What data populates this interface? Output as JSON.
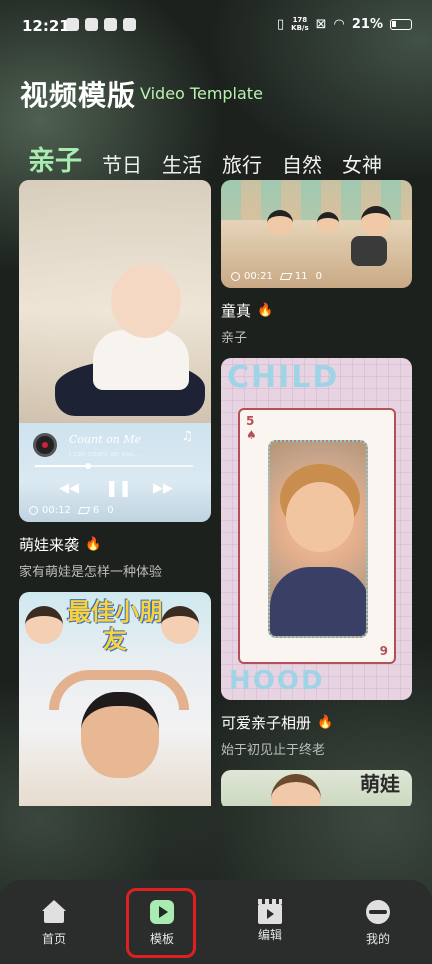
{
  "status_bar": {
    "time": "12:21",
    "net_speed_value": "178",
    "net_speed_unit": "KB/s",
    "battery": "21%"
  },
  "header": {
    "title": "视频模版",
    "subtitle": "Video Template"
  },
  "tabs": [
    {
      "label": "亲子",
      "active": true
    },
    {
      "label": "节日",
      "active": false
    },
    {
      "label": "生活",
      "active": false
    },
    {
      "label": "旅行",
      "active": false
    },
    {
      "label": "自然",
      "active": false
    },
    {
      "label": "女神",
      "active": false
    }
  ],
  "templates": [
    {
      "title": "萌娃来袭",
      "subtitle": "家有萌娃是怎样一种体验",
      "duration": "00:12",
      "clips": "6",
      "uses": "0",
      "song_title": "Count on Me",
      "song_lyric": "I can count on you..."
    },
    {
      "title": "童真",
      "subtitle": "亲子",
      "duration": "00:21",
      "clips": "11",
      "uses": "0"
    },
    {
      "title": "可爱亲子相册",
      "subtitle": "始于初见止于终老",
      "poster_top": "CHILD",
      "poster_bottom": "HOOD",
      "rank_top": "5",
      "rank_bottom": "9"
    },
    {
      "banner": "最佳小朋友"
    },
    {
      "banner": "萌娃"
    }
  ],
  "bottom_nav": [
    {
      "label": "首页",
      "icon": "home-icon"
    },
    {
      "label": "模板",
      "icon": "play-icon",
      "active": true
    },
    {
      "label": "编辑",
      "icon": "clapperboard-icon"
    },
    {
      "label": "我的",
      "icon": "profile-icon"
    }
  ],
  "colors": {
    "accent": "#a9ecb1",
    "subtitle": "#b9f2b0",
    "fire": "#ff9a2e",
    "highlight": "#e02020"
  }
}
